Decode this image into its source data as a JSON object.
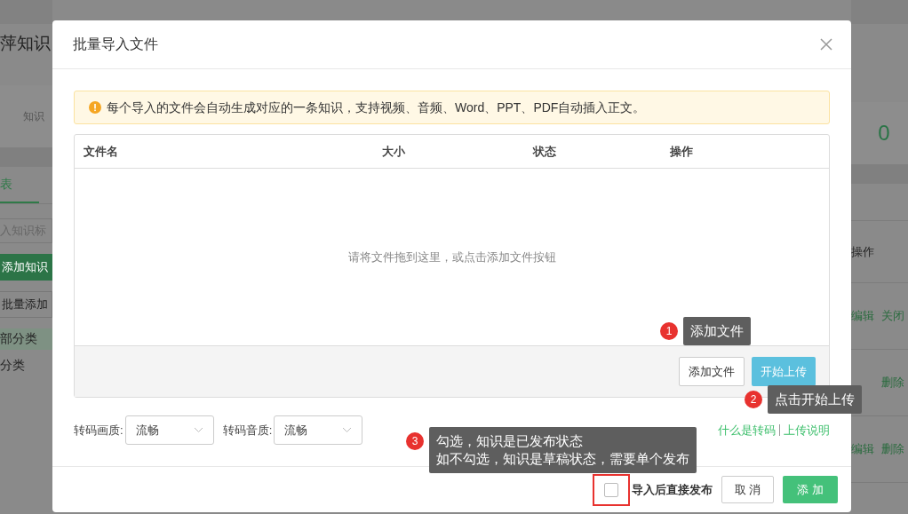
{
  "page": {
    "title": "萍知识",
    "stat_label": "知识",
    "stat_value": "0",
    "tab": "表",
    "search": {
      "placeholder": "入知识标"
    },
    "buttons": [
      "添加知识",
      "批量添加"
    ],
    "categories": [
      {
        "label": "部分类",
        "selected": true
      },
      {
        "label": "分类",
        "selected": false
      }
    ],
    "table": {
      "column": "操作",
      "rows": [
        {
          "actions": [
            "编辑",
            "关闭"
          ]
        },
        {
          "actions": [
            "删除"
          ]
        },
        {
          "actions": [
            "编辑",
            "删除"
          ]
        }
      ]
    }
  },
  "dialog": {
    "title": "批量导入文件",
    "notice": "每个导入的文件会自动生成对应的一条知识，支持视频、音频、Word、PPT、PDF自动插入正文。",
    "table": {
      "columns": [
        "文件名",
        "大小",
        "状态",
        "操作"
      ],
      "empty_hint": "请将文件拖到这里，或点击添加文件按钮",
      "buttons": [
        "添加文件",
        "开始上传"
      ]
    },
    "settings": [
      {
        "label": "转码画质:",
        "value": "流畅"
      },
      {
        "label": "转码音质:",
        "value": "流畅"
      }
    ],
    "links": [
      "什么是转码",
      "上传说明"
    ],
    "publish": {
      "label": "导入后直接发布",
      "checked": false
    },
    "buttons": [
      "取 消",
      "添 加"
    ]
  },
  "callouts": [
    {
      "number": "1",
      "lines": [
        "添加文件"
      ]
    },
    {
      "number": "2",
      "lines": [
        "点击开始上传"
      ]
    },
    {
      "number": "3",
      "lines": [
        "勾选，知识是已发布状态",
        "如不勾选，知识是草稿状态，需要单个发布"
      ]
    }
  ]
}
